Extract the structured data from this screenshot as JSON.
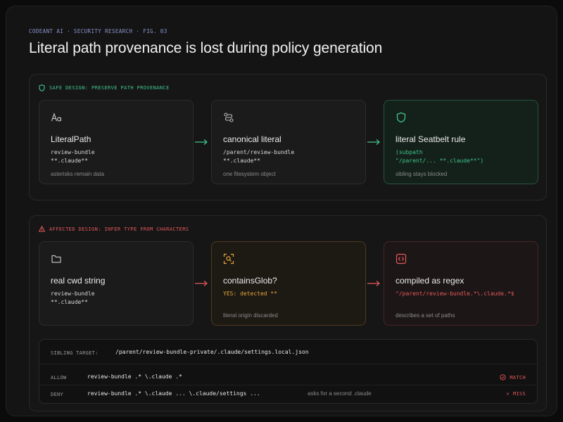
{
  "header": {
    "kicker": "CODEANT AI · SECURITY RESEARCH · FIG. 03",
    "title": "Literal path provenance is lost during policy generation"
  },
  "safe": {
    "label": "SAFE DESIGN: PRESERVE PATH PROVENANCE",
    "cards": [
      {
        "title": "LiteralPath",
        "lines": [
          "review-bundle",
          "**.claude**"
        ],
        "note": "asterisks remain data",
        "icon": "text-aa-icon"
      },
      {
        "title": "canonical literal",
        "lines": [
          "/parent/review-bundle",
          "**.claude**"
        ],
        "note": "one filesystem object",
        "icon": "path-nodes-icon"
      },
      {
        "title": "literal Seatbelt rule",
        "lines": [
          "(subpath",
          "\"/parent/... **.claude**\")"
        ],
        "note": "sibling stays blocked",
        "icon": "shield-icon"
      }
    ]
  },
  "affected": {
    "label": "AFFECTED DESIGN: INFER TYPE FROM CHARACTERS",
    "cards": [
      {
        "title": "real cwd string",
        "lines": [
          "review-bundle",
          "**.claude**"
        ],
        "note": "",
        "icon": "folder-icon"
      },
      {
        "title": "containsGlob?",
        "lines": [
          "YES: detected **"
        ],
        "note": "literal origin discarded",
        "icon": "search-box-icon"
      },
      {
        "title": "compiled as regex",
        "lines": [
          "^/parent/review-bundle.*\\.claude.*$"
        ],
        "note": "describes a set of paths",
        "icon": "code-icon"
      }
    ]
  },
  "target": {
    "label": "SIBLING TARGET:",
    "path": "/parent/review-bundle-private/.claude/settings.local.json",
    "rows": [
      {
        "kind": "ALLOW",
        "pattern": "review-bundle .* \\.claude .*",
        "note": "",
        "status": "MATCH"
      },
      {
        "kind": "DENY",
        "pattern": "review-bundle .* \\.claude ... \\.claude/settings ...",
        "note": "asks for a second .claude",
        "status": "MISS"
      }
    ]
  },
  "colors": {
    "green": "#3fc48a",
    "amber": "#e8a33b",
    "red": "#e4585a",
    "kicker": "#8a93c9"
  }
}
